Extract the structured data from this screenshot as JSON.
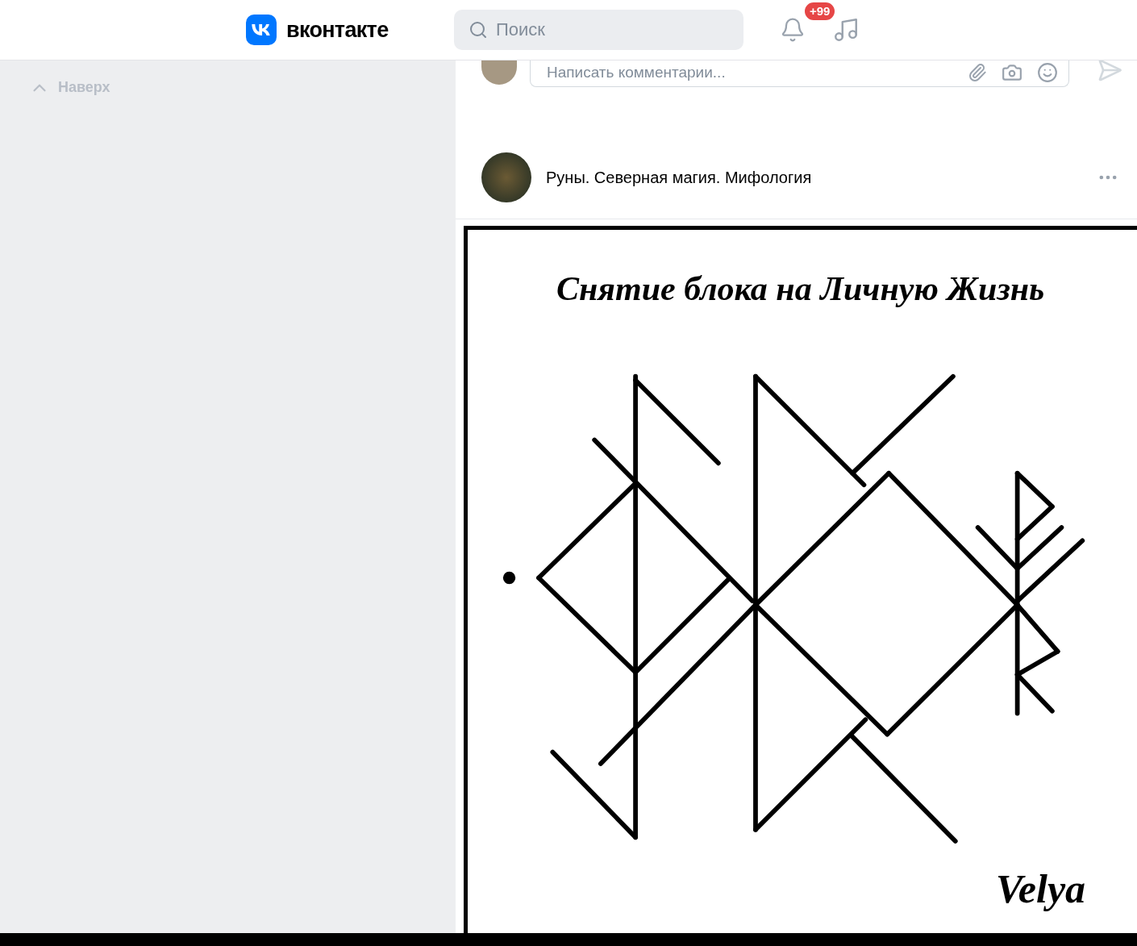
{
  "header": {
    "logo": "вконтакте",
    "search": {
      "placeholder": "Поиск"
    },
    "notifications_badge": "+99"
  },
  "sidebar": {
    "back_to_top": "Наверх"
  },
  "comment_box": {
    "placeholder": "Написать комментарии..."
  },
  "post": {
    "author": "Руны. Северная магия. Мифология",
    "image": {
      "title": "Снятие блока на Личную Жизнь",
      "signature": "Velya"
    }
  }
}
